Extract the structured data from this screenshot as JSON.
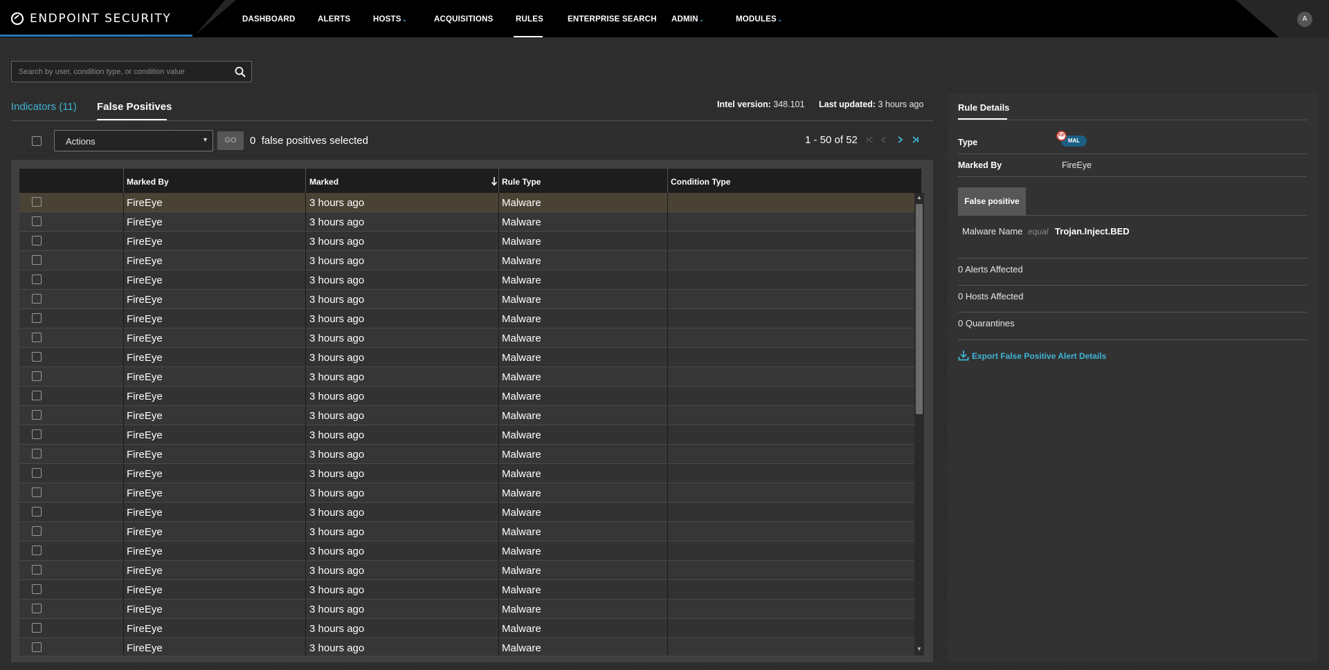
{
  "app": {
    "brand": "ENDPOINT SECURITY",
    "avatar_initial": "A",
    "accent_color": "#3fb4d4"
  },
  "nav": {
    "items": [
      {
        "label": "DASHBOARD",
        "has_dropdown": false,
        "active": false
      },
      {
        "label": "ALERTS",
        "has_dropdown": false,
        "active": false
      },
      {
        "label": "HOSTS",
        "has_dropdown": true,
        "active": false
      },
      {
        "label": "ACQUISITIONS",
        "has_dropdown": false,
        "active": false
      },
      {
        "label": "RULES",
        "has_dropdown": false,
        "active": true
      },
      {
        "label": "ENTERPRISE SEARCH",
        "has_dropdown": false,
        "active": false
      },
      {
        "label": "ADMIN",
        "has_dropdown": true,
        "active": false
      },
      {
        "label": "MODULES",
        "has_dropdown": true,
        "active": false
      }
    ]
  },
  "search": {
    "placeholder": "Search by user, condition type, or condition value",
    "value": ""
  },
  "tabs": {
    "indicators": "Indicators (11)",
    "false_positives": "False Positives"
  },
  "intel": {
    "version_label": "Intel version:",
    "version_value": "348.101",
    "updated_label": "Last updated:",
    "updated_value": "3 hours ago"
  },
  "toolbar": {
    "actions_label": "Actions",
    "go_label": "GO",
    "selected_count": "0",
    "selected_text": "false positives selected",
    "page_range": "1 - 50 of 52"
  },
  "grid": {
    "columns": [
      "Marked By",
      "Marked",
      "Rule Type",
      "Condition Type"
    ],
    "rows": [
      {
        "marked_by": "FireEye",
        "marked": "3 hours ago",
        "rule_type": "Malware",
        "condition_type": ""
      },
      {
        "marked_by": "FireEye",
        "marked": "3 hours ago",
        "rule_type": "Malware",
        "condition_type": ""
      },
      {
        "marked_by": "FireEye",
        "marked": "3 hours ago",
        "rule_type": "Malware",
        "condition_type": ""
      },
      {
        "marked_by": "FireEye",
        "marked": "3 hours ago",
        "rule_type": "Malware",
        "condition_type": ""
      },
      {
        "marked_by": "FireEye",
        "marked": "3 hours ago",
        "rule_type": "Malware",
        "condition_type": ""
      },
      {
        "marked_by": "FireEye",
        "marked": "3 hours ago",
        "rule_type": "Malware",
        "condition_type": ""
      },
      {
        "marked_by": "FireEye",
        "marked": "3 hours ago",
        "rule_type": "Malware",
        "condition_type": ""
      },
      {
        "marked_by": "FireEye",
        "marked": "3 hours ago",
        "rule_type": "Malware",
        "condition_type": ""
      },
      {
        "marked_by": "FireEye",
        "marked": "3 hours ago",
        "rule_type": "Malware",
        "condition_type": ""
      },
      {
        "marked_by": "FireEye",
        "marked": "3 hours ago",
        "rule_type": "Malware",
        "condition_type": ""
      },
      {
        "marked_by": "FireEye",
        "marked": "3 hours ago",
        "rule_type": "Malware",
        "condition_type": ""
      },
      {
        "marked_by": "FireEye",
        "marked": "3 hours ago",
        "rule_type": "Malware",
        "condition_type": ""
      },
      {
        "marked_by": "FireEye",
        "marked": "3 hours ago",
        "rule_type": "Malware",
        "condition_type": ""
      },
      {
        "marked_by": "FireEye",
        "marked": "3 hours ago",
        "rule_type": "Malware",
        "condition_type": ""
      },
      {
        "marked_by": "FireEye",
        "marked": "3 hours ago",
        "rule_type": "Malware",
        "condition_type": ""
      },
      {
        "marked_by": "FireEye",
        "marked": "3 hours ago",
        "rule_type": "Malware",
        "condition_type": ""
      },
      {
        "marked_by": "FireEye",
        "marked": "3 hours ago",
        "rule_type": "Malware",
        "condition_type": ""
      },
      {
        "marked_by": "FireEye",
        "marked": "3 hours ago",
        "rule_type": "Malware",
        "condition_type": ""
      },
      {
        "marked_by": "FireEye",
        "marked": "3 hours ago",
        "rule_type": "Malware",
        "condition_type": ""
      },
      {
        "marked_by": "FireEye",
        "marked": "3 hours ago",
        "rule_type": "Malware",
        "condition_type": ""
      },
      {
        "marked_by": "FireEye",
        "marked": "3 hours ago",
        "rule_type": "Malware",
        "condition_type": ""
      },
      {
        "marked_by": "FireEye",
        "marked": "3 hours ago",
        "rule_type": "Malware",
        "condition_type": ""
      },
      {
        "marked_by": "FireEye",
        "marked": "3 hours ago",
        "rule_type": "Malware",
        "condition_type": ""
      },
      {
        "marked_by": "FireEye",
        "marked": "3 hours ago",
        "rule_type": "Malware",
        "condition_type": ""
      }
    ]
  },
  "details": {
    "title": "Rule Details",
    "type_label": "Type",
    "badge_fp": "FP",
    "badge_mal": "MAL",
    "marked_by_label": "Marked By",
    "marked_by_value": "FireEye",
    "fp_tab": "False positive",
    "condition": {
      "field": "Malware Name",
      "operator": "equal",
      "value": "Trojan.Inject.BED"
    },
    "alerts_affected": "0 Alerts Affected",
    "hosts_affected": "0 Hosts Affected",
    "quarantines": "0 Quarantines",
    "export_label": "Export False Positive Alert Details"
  }
}
